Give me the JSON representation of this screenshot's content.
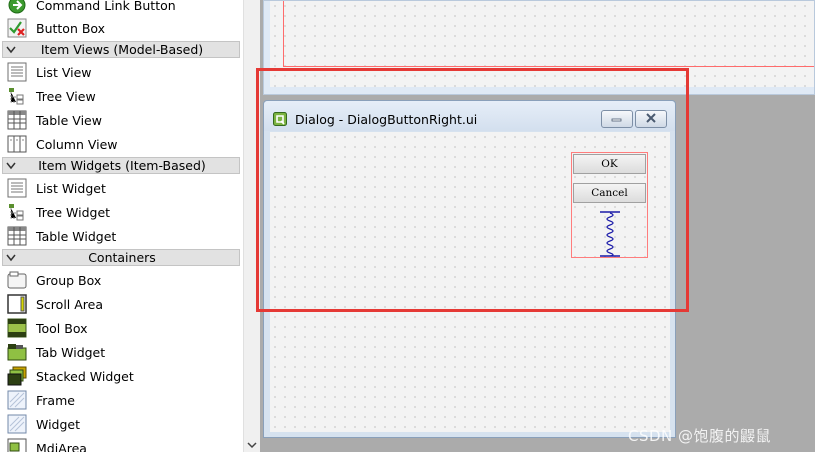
{
  "widget_box": {
    "items": [
      {
        "label": "Command Link Button",
        "icon": "command-link-icon"
      },
      {
        "label": "Button Box",
        "icon": "button-box-icon"
      },
      {
        "label": "List View",
        "icon": "list-view-icon"
      },
      {
        "label": "Tree View",
        "icon": "tree-view-icon"
      },
      {
        "label": "Table View",
        "icon": "table-view-icon"
      },
      {
        "label": "Column View",
        "icon": "column-view-icon"
      },
      {
        "label": "List Widget",
        "icon": "list-widget-icon"
      },
      {
        "label": "Tree Widget",
        "icon": "tree-widget-icon"
      },
      {
        "label": "Table Widget",
        "icon": "table-widget-icon"
      },
      {
        "label": "Group Box",
        "icon": "group-box-icon"
      },
      {
        "label": "Scroll Area",
        "icon": "scroll-area-icon"
      },
      {
        "label": "Tool Box",
        "icon": "tool-box-icon"
      },
      {
        "label": "Tab Widget",
        "icon": "tab-widget-icon"
      },
      {
        "label": "Stacked Widget",
        "icon": "stacked-widget-icon"
      },
      {
        "label": "Frame",
        "icon": "frame-icon"
      },
      {
        "label": "Widget",
        "icon": "widget-icon"
      },
      {
        "label": "MdiArea",
        "icon": "mdi-area-icon"
      }
    ],
    "categories": [
      {
        "label": "Item Views (Model-Based)"
      },
      {
        "label": "Item Widgets (Item-Based)"
      },
      {
        "label": "Containers"
      }
    ]
  },
  "dialog": {
    "title": "Dialog - DialogButtonRight.ui",
    "ok_label": "OK",
    "cancel_label": "Cancel"
  },
  "watermark": "CSDN @饱腹的鼹鼠",
  "colors": {
    "highlight": "#e53935",
    "layout_border": "#ff7c7c",
    "spacer": "#1a1aa8"
  }
}
